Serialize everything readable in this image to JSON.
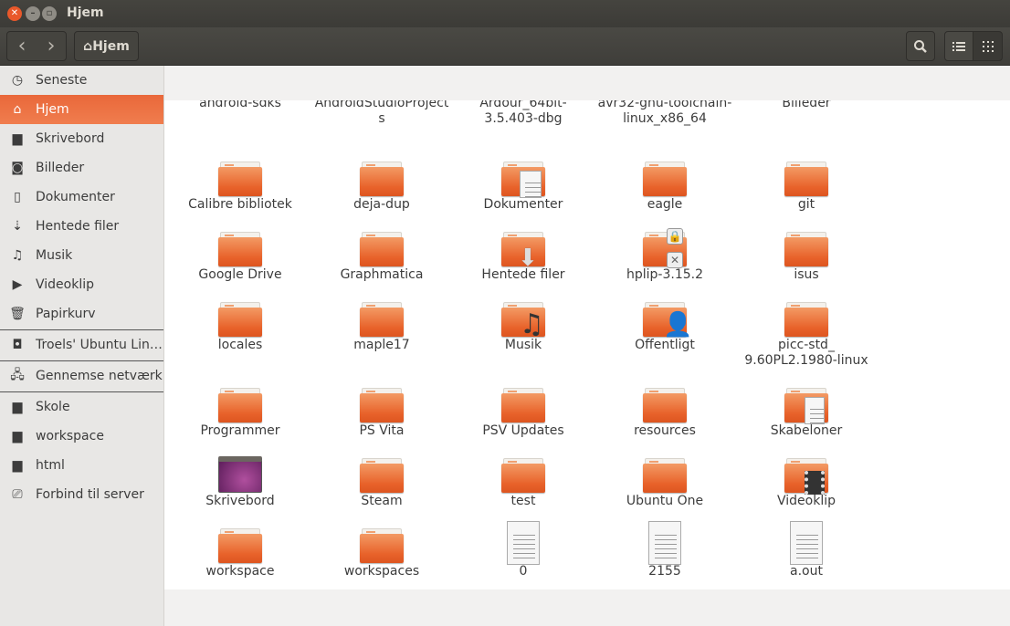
{
  "window": {
    "title": "Hjem"
  },
  "toolbar": {
    "back": "‹",
    "forward": "›",
    "path_label": "Hjem"
  },
  "sidebar": {
    "items": [
      {
        "label": "Seneste",
        "icon": "clock-icon",
        "glyph": "◷"
      },
      {
        "label": "Hjem",
        "icon": "home-icon",
        "glyph": "⌂",
        "active": true
      },
      {
        "label": "Skrivebord",
        "icon": "folder-icon",
        "glyph": "▆"
      },
      {
        "label": "Billeder",
        "icon": "camera-icon",
        "glyph": "◙"
      },
      {
        "label": "Dokumenter",
        "icon": "document-icon",
        "glyph": "▯"
      },
      {
        "label": "Hentede filer",
        "icon": "download-icon",
        "glyph": "⇣"
      },
      {
        "label": "Musik",
        "icon": "music-icon",
        "glyph": "♫"
      },
      {
        "label": "Videoklip",
        "icon": "video-icon",
        "glyph": "▶"
      },
      {
        "label": "Papirkurv",
        "icon": "trash-icon",
        "glyph": "🗑"
      },
      {
        "label": "Troels' Ubuntu Lin…",
        "icon": "drive-icon",
        "glyph": "◘"
      },
      {
        "label": "Gennemse netværk",
        "icon": "network-icon",
        "glyph": "🖧"
      },
      {
        "label": "Skole",
        "icon": "folder-icon",
        "glyph": "▆"
      },
      {
        "label": "workspace",
        "icon": "folder-icon",
        "glyph": "▆"
      },
      {
        "label": "html",
        "icon": "folder-icon",
        "glyph": "▆"
      },
      {
        "label": "Forbind til server",
        "icon": "server-icon",
        "glyph": "⎚"
      }
    ]
  },
  "files": [
    {
      "name": "android-sdks",
      "type": "folder"
    },
    {
      "name": "AndroidStudioProjects",
      "type": "folder"
    },
    {
      "name": "Ardour_64bit-3.5.403-dbg",
      "type": "folder"
    },
    {
      "name": "avr32-gnu-toolchain-linux_x86_64",
      "type": "folder"
    },
    {
      "name": "Billeder",
      "type": "folder"
    },
    {
      "name": "Calibre bibliotek",
      "type": "folder"
    },
    {
      "name": "deja-dup",
      "type": "folder"
    },
    {
      "name": "Dokumenter",
      "type": "folder-documents"
    },
    {
      "name": "eagle",
      "type": "folder"
    },
    {
      "name": "git",
      "type": "folder"
    },
    {
      "name": "Google Drive",
      "type": "folder"
    },
    {
      "name": "Graphmatica",
      "type": "folder"
    },
    {
      "name": "Hentede filer",
      "type": "folder-download"
    },
    {
      "name": "hplip-3.15.2",
      "type": "folder-locked"
    },
    {
      "name": "isus",
      "type": "folder"
    },
    {
      "name": "locales",
      "type": "folder"
    },
    {
      "name": "maple17",
      "type": "folder"
    },
    {
      "name": "Musik",
      "type": "folder-music"
    },
    {
      "name": "Offentligt",
      "type": "folder-public"
    },
    {
      "name": "picc-std_ 9.60PL2.1980-linux",
      "type": "folder"
    },
    {
      "name": "Programmer",
      "type": "folder"
    },
    {
      "name": "PS Vita",
      "type": "folder"
    },
    {
      "name": "PSV Updates",
      "type": "folder"
    },
    {
      "name": "resources",
      "type": "folder"
    },
    {
      "name": "Skabeloner",
      "type": "folder-templates"
    },
    {
      "name": "Skrivebord",
      "type": "desktop"
    },
    {
      "name": "Steam",
      "type": "folder"
    },
    {
      "name": "test",
      "type": "folder"
    },
    {
      "name": "Ubuntu One",
      "type": "folder"
    },
    {
      "name": "Videoklip",
      "type": "folder-video"
    },
    {
      "name": "workspace",
      "type": "folder"
    },
    {
      "name": "workspaces",
      "type": "folder"
    },
    {
      "name": "0",
      "type": "text-file"
    },
    {
      "name": "2155",
      "type": "text-file"
    },
    {
      "name": "a.out",
      "type": "text-file"
    }
  ],
  "colors": {
    "accent": "#e9683a",
    "folder": "#e8622a"
  }
}
